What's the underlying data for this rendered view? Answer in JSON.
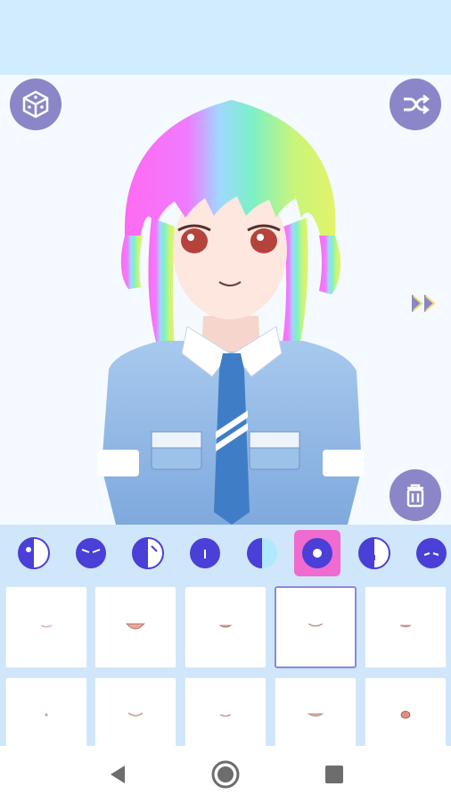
{
  "toolbar": {
    "random_icon": "dice-icon",
    "shuffle_icon": "shuffle-icon",
    "next_icon": "double-chevron-right-icon",
    "delete_icon": "trash-icon"
  },
  "colors": {
    "accent_button": "#8a86c7",
    "selected_tab": "#f06bd0",
    "selected_cell_border": "#8f86db",
    "category_bar": "#cfe6fb"
  },
  "category_tabs": [
    {
      "icon": "eye-style-icon-1",
      "selected": false
    },
    {
      "icon": "eye-style-icon-2",
      "selected": false
    },
    {
      "icon": "eye-style-icon-3",
      "selected": false
    },
    {
      "icon": "eye-style-icon-4",
      "selected": false
    },
    {
      "icon": "eye-style-icon-5",
      "selected": false
    },
    {
      "icon": "mouth-category-icon",
      "selected": true
    },
    {
      "icon": "eye-style-icon-6",
      "selected": false
    },
    {
      "icon": "eye-style-icon-7",
      "selected": false
    }
  ],
  "mouth_options": [
    {
      "icon": "mouth-option-1",
      "selected": false
    },
    {
      "icon": "mouth-option-2",
      "selected": false
    },
    {
      "icon": "mouth-option-3",
      "selected": false
    },
    {
      "icon": "mouth-option-4",
      "selected": true
    },
    {
      "icon": "mouth-option-5",
      "selected": false
    },
    {
      "icon": "mouth-option-6",
      "selected": false
    },
    {
      "icon": "mouth-option-7",
      "selected": false
    },
    {
      "icon": "mouth-option-8",
      "selected": false
    },
    {
      "icon": "mouth-option-9",
      "selected": false
    },
    {
      "icon": "mouth-option-10",
      "selected": false
    }
  ],
  "navbar": {
    "back_icon": "back-triangle-icon",
    "home_icon": "home-circle-icon",
    "recents_icon": "recents-square-icon"
  }
}
